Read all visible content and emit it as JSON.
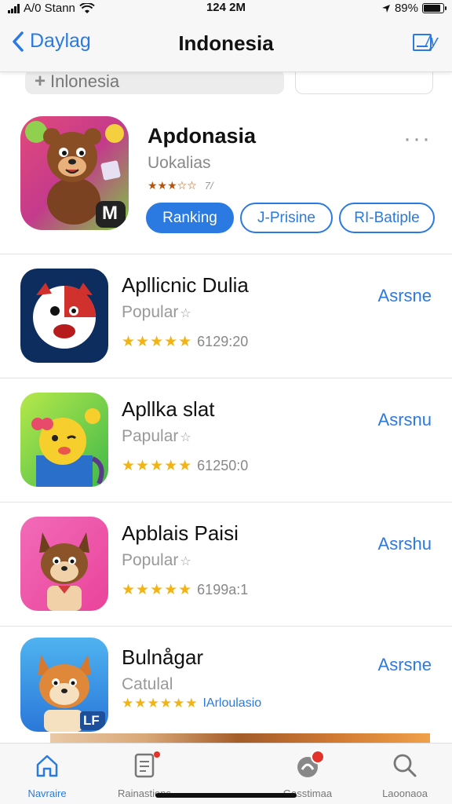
{
  "status": {
    "carrier": "A/0 Stann",
    "time": "124 2M",
    "battery": "89%"
  },
  "nav": {
    "back_label": "Daylag",
    "title": "Indonesia",
    "edit_label": "/y"
  },
  "search": {
    "value": "Inlonesia"
  },
  "featured": {
    "name": "Apdonasia",
    "subtitle": "Uokalias",
    "stars": "★★★☆☆",
    "rating_text": "7/",
    "buttons": [
      "Ranking",
      "J-Prisine",
      "RI-Batiple"
    ],
    "icon_letter": "M"
  },
  "apps": [
    {
      "name": "Apllicnic Dulia",
      "category": "Popular",
      "stars": "★★★★★",
      "count": "6129:20",
      "action": "Asrsne"
    },
    {
      "name": "Apllka slat",
      "category": "Papular",
      "stars": "★★★★★",
      "count": "61250:0",
      "action": "Asrsnu"
    },
    {
      "name": "Apblais Paisi",
      "category": "Popular",
      "stars": "★★★★★",
      "count": "6199a:1",
      "action": "Asrshu"
    },
    {
      "name": "Bulnågar",
      "category": "Catulal",
      "stars": "★★★★★★",
      "count": "IArloulasio",
      "action": "Asrsne",
      "icon_letter": "LF"
    }
  ],
  "tabs": [
    {
      "label": "Navraire"
    },
    {
      "label": "Rainastions"
    },
    {
      "label": "Gasstimaa"
    },
    {
      "label": "Laoonaoa"
    }
  ],
  "colors": {
    "accent": "#2a7ae2",
    "star": "#f2b413",
    "badge": "#e2342b"
  }
}
